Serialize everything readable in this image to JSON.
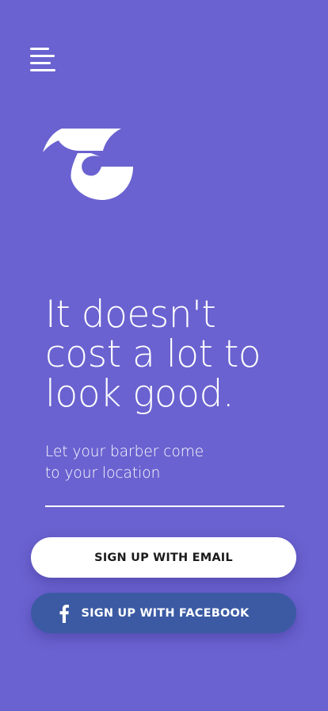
{
  "colors": {
    "background": "#6A62D0",
    "primary_button": "#FFFFFF",
    "facebook_button": "#3B5AA3",
    "text": "#FFFFFF"
  },
  "header": {
    "menu_icon": "hamburger-menu-icon"
  },
  "brand": {
    "logo_icon": "brand-logo-icon"
  },
  "hero": {
    "headline_lines": [
      "It doesn't",
      "cost a lot to",
      "look good."
    ],
    "subtitle_lines": [
      "Let your barber come",
      "to your location"
    ]
  },
  "actions": {
    "email_signup_label": "SIGN UP WITH EMAIL",
    "facebook_signup_label": "SIGN UP WITH FACEBOOK",
    "facebook_icon": "facebook-f-icon"
  }
}
